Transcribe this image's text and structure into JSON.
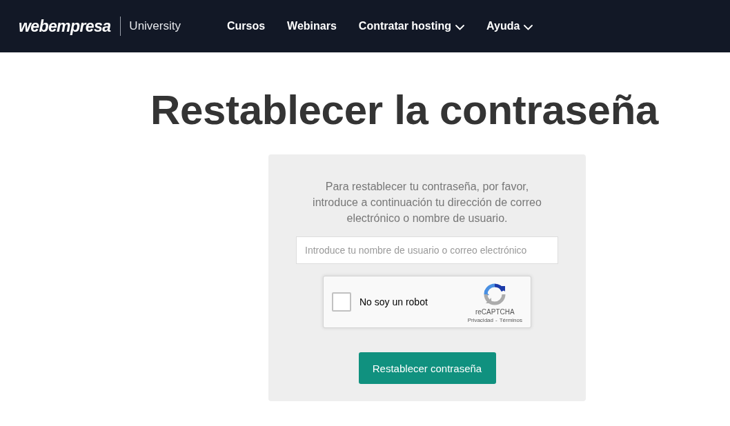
{
  "header": {
    "logo": "webempresa",
    "subtitle": "University",
    "nav": [
      {
        "label": "Cursos",
        "has_menu": false
      },
      {
        "label": "Webinars",
        "has_menu": false
      },
      {
        "label": "Contratar hosting",
        "has_menu": true
      },
      {
        "label": "Ayuda",
        "has_menu": true
      }
    ]
  },
  "page": {
    "title": "Restablecer la contraseña"
  },
  "form": {
    "instructions": "Para restablecer tu contraseña, por favor, introduce a continuación tu dirección de correo electrónico o nombre de usuario.",
    "username_field": {
      "placeholder": "Introduce tu nombre de usuario o correo electrónico"
    },
    "captcha": {
      "label": "No soy un robot",
      "checked": false,
      "brand": "reCAPTCHA",
      "privacy_link": "Privacidad",
      "separator": "-",
      "terms_link": "Términos"
    },
    "submit_button": "Restablecer contraseña"
  }
}
